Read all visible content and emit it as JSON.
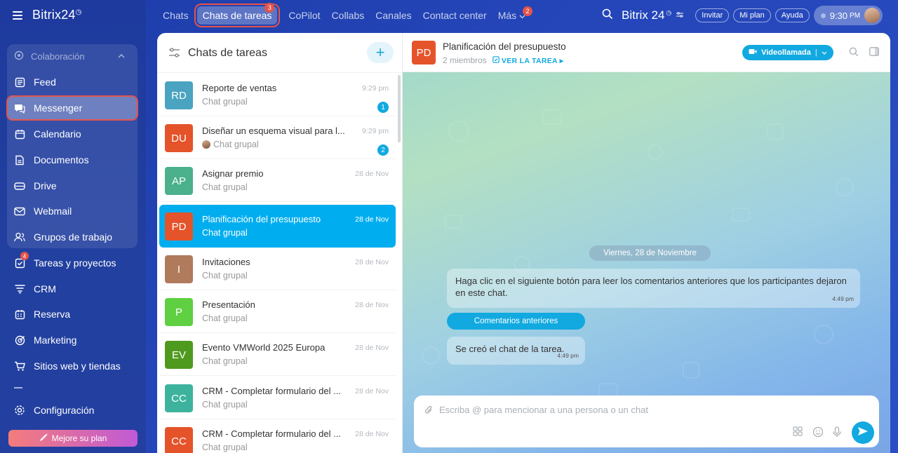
{
  "app": {
    "logo": "Bitrix24",
    "logo_symbol": "◷"
  },
  "topnav": {
    "tabs": [
      {
        "label": "Chats",
        "badge": ""
      },
      {
        "label": "Chats de tareas",
        "badge": "3"
      },
      {
        "label": "CoPilot",
        "badge": ""
      },
      {
        "label": "Collabs",
        "badge": ""
      },
      {
        "label": "Canales",
        "badge": ""
      },
      {
        "label": "Contact center",
        "badge": ""
      },
      {
        "label": "Más",
        "badge": "2"
      }
    ],
    "brand": "Bitrix 24",
    "invite": "Invitar",
    "plan": "Mi plan",
    "help": "Ayuda",
    "time": "9:30",
    "time_suffix": "PM"
  },
  "sidebar": {
    "group_label": "Colaboración",
    "items": [
      {
        "label": "Feed",
        "icon": "feed-icon"
      },
      {
        "label": "Messenger",
        "icon": "messenger-icon"
      },
      {
        "label": "Calendario",
        "icon": "calendar-icon"
      },
      {
        "label": "Documentos",
        "icon": "document-icon"
      },
      {
        "label": "Drive",
        "icon": "drive-icon"
      },
      {
        "label": "Webmail",
        "icon": "mail-icon"
      },
      {
        "label": "Grupos de trabajo",
        "icon": "groups-icon"
      },
      {
        "label": "Tareas y proyectos",
        "icon": "tasks-icon",
        "badge": "4"
      },
      {
        "label": "CRM",
        "icon": "crm-icon"
      },
      {
        "label": "Reserva",
        "icon": "booking-icon"
      },
      {
        "label": "Marketing",
        "icon": "marketing-icon"
      },
      {
        "label": "Sitios web y tiendas",
        "icon": "cart-icon"
      },
      {
        "label": "Configuración",
        "icon": "gear-icon"
      }
    ],
    "upgrade": "Mejore su plan"
  },
  "chat_list": {
    "title": "Chats de tareas",
    "chats": [
      {
        "initials": "RD",
        "color": "#4aa3c1",
        "name": "Reporte de ventas",
        "sub": "Chat grupal",
        "time": "9:29 pm",
        "unread": "1"
      },
      {
        "initials": "DU",
        "color": "#e5532a",
        "name": "Diseñar un esquema visual para l...",
        "sub": "Chat grupal",
        "time": "9:29 pm",
        "unread": "2"
      },
      {
        "initials": "AP",
        "color": "#4bb08c",
        "name": "Asignar premio",
        "sub": "Chat grupal",
        "time": "28 de Nov",
        "unread": ""
      },
      {
        "initials": "PD",
        "color": "#e5532a",
        "name": "Planificación del presupuesto",
        "sub": "Chat grupal",
        "time": "28 de Nov",
        "unread": ""
      },
      {
        "initials": "I",
        "color": "#b07a5c",
        "name": "Invitaciones",
        "sub": "Chat grupal",
        "time": "28 de Nov",
        "unread": ""
      },
      {
        "initials": "P",
        "color": "#5fd042",
        "name": "Presentación",
        "sub": "Chat grupal",
        "time": "28 de Nov",
        "unread": ""
      },
      {
        "initials": "EV",
        "color": "#4e9a1f",
        "name": "Evento VMWorld 2025 Europa",
        "sub": "Chat grupal",
        "time": "28 de Nov",
        "unread": ""
      },
      {
        "initials": "CC",
        "color": "#3db39e",
        "name": "CRM - Completar formulario del ...",
        "sub": "Chat grupal",
        "time": "28 de Nov",
        "unread": ""
      },
      {
        "initials": "CC",
        "color": "#e5532a",
        "name": "CRM - Completar formulario del ...",
        "sub": "Chat grupal",
        "time": "28 de Nov",
        "unread": ""
      }
    ]
  },
  "chat_view": {
    "avatar": "PD",
    "title": "Planificación del presupuesto",
    "members": "2 miembros",
    "task_link": "VER LA TAREA",
    "video_call": "Videollamada",
    "date_divider": "Viernes, 28 de Noviembre",
    "messages": [
      {
        "text": "Haga clic en el siguiente botón para leer los comentarios anteriores que los participantes dejaron en este chat.",
        "time": "4:49 pm"
      },
      {
        "text": "Se creó el chat de la tarea.",
        "time": "4:49 pm"
      }
    ],
    "previous_comments": "Comentarios anteriores",
    "composer_placeholder": "Escriba @ para mencionar a una persona o un chat"
  },
  "colors": {
    "accent": "#11a9e0",
    "highlight": "#e5534b"
  }
}
